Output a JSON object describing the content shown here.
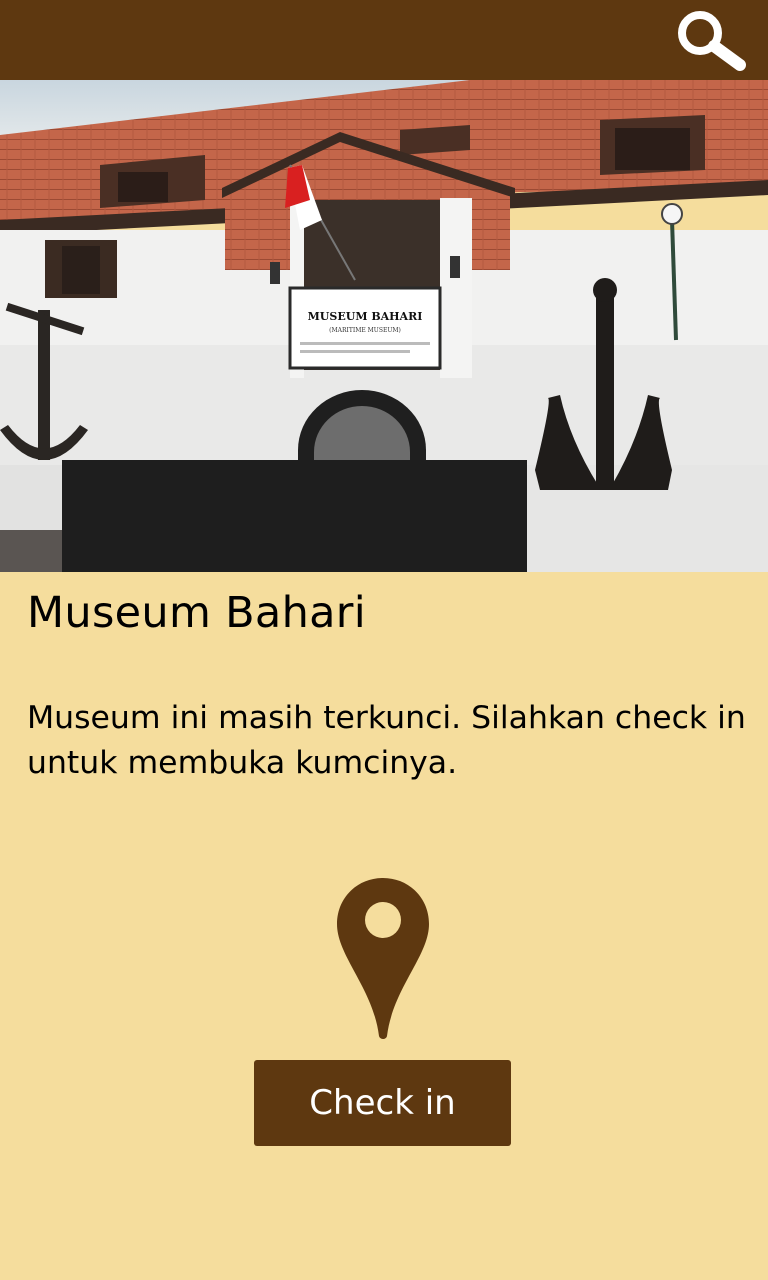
{
  "header": {
    "search_icon": "search-icon",
    "bar_color": "#5e3810"
  },
  "hero": {
    "sign_title": "MUSEUM BAHARI",
    "sign_subtitle": "(MARITIME MUSEUM)"
  },
  "museum": {
    "title": "Museum Bahari",
    "locked_message": "Museum ini masih terkunci. Silahkan check in untuk membuka kumcinya.",
    "pin_icon": "location-pin-icon"
  },
  "actions": {
    "checkin_label": "Check in"
  },
  "colors": {
    "accent": "#5e3810",
    "background": "#f5dd9d"
  }
}
